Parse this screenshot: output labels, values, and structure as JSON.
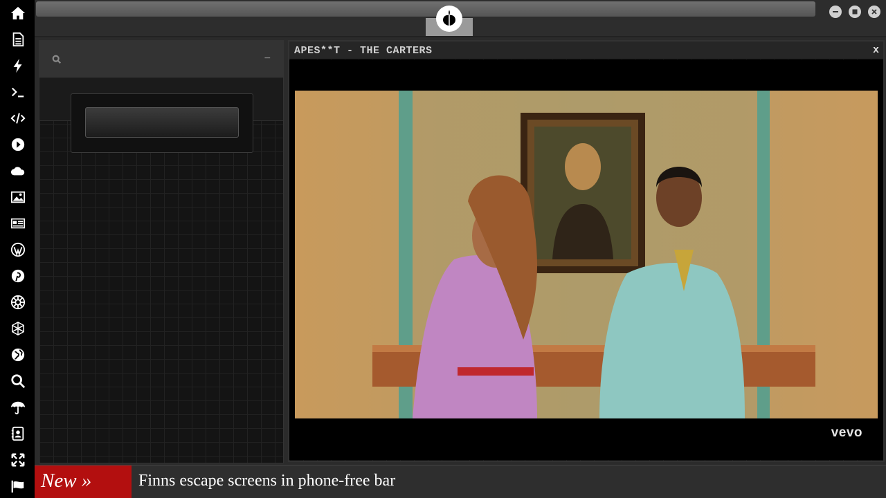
{
  "window": {
    "buttons": [
      "minimize",
      "maximize",
      "close"
    ]
  },
  "sidebar": {
    "icons": [
      "home-icon",
      "document-icon",
      "lightning-icon",
      "terminal-icon",
      "code-icon",
      "play-icon",
      "cloud-icon",
      "image-icon",
      "newspaper-icon",
      "wordpress-icon",
      "pinterest-icon",
      "empire-icon",
      "polyhedron-icon",
      "globe-icon",
      "search-icon",
      "umbrella-icon",
      "contacts-icon",
      "expand-icon",
      "flag-icon"
    ]
  },
  "left_panel": {
    "search_placeholder": "",
    "collapse_label": "−"
  },
  "video": {
    "title": "APES**T - THE CARTERS",
    "close_label": "x",
    "watermark": "vevo"
  },
  "ticker": {
    "label": "New »",
    "headline": "Finns escape screens in phone-free bar"
  },
  "colors": {
    "ticker_label_bg": "#b30f0f",
    "sidebar_bg": "#000000",
    "panel_bg": "#141414"
  }
}
